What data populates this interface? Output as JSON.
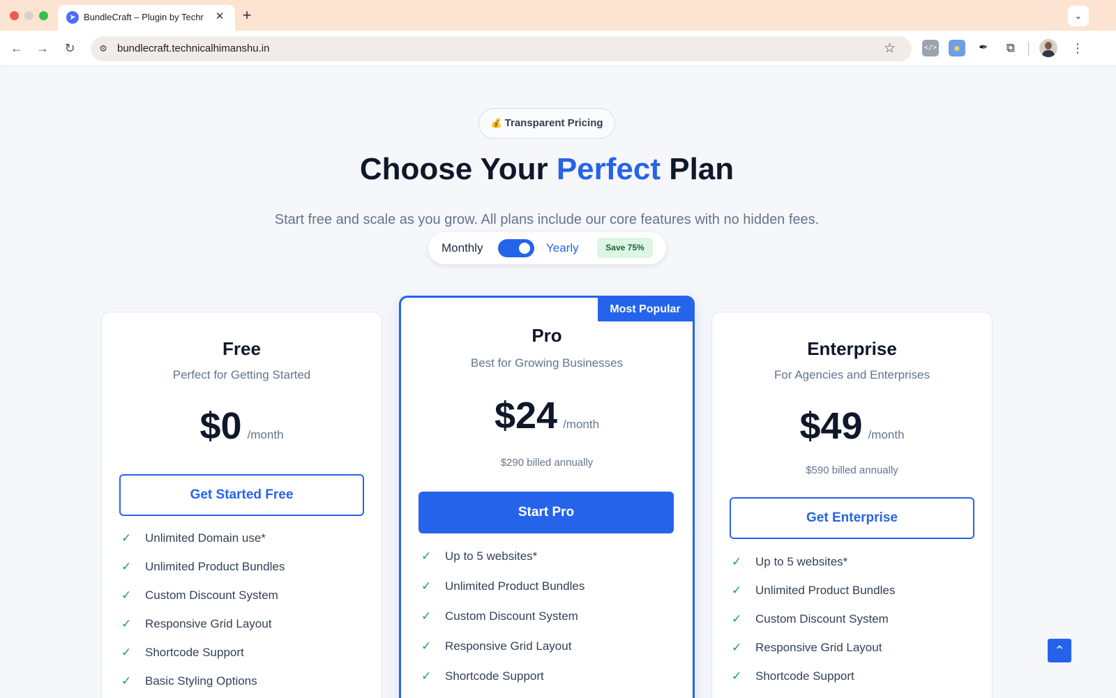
{
  "browser": {
    "tab_title": "BundleCraft – Plugin by Techr",
    "tab_favicon": "rocket-icon",
    "new_tab_symbol": "+",
    "close_symbol": "✕",
    "url": "bundlecraft.technicalhimanshu.in"
  },
  "hero": {
    "badge_emoji": "💰",
    "badge_text": "Transparent Pricing",
    "headline_before": "Choose Your ",
    "headline_accent": "Perfect",
    "headline_after": " Plan",
    "subtitle": "Start free and scale as you grow. All plans include our core features with no hidden fees."
  },
  "billing": {
    "monthly_label": "Monthly",
    "yearly_label": "Yearly",
    "save_label": "Save 75%",
    "yearly_selected": true
  },
  "plans": [
    {
      "name": "Free",
      "description": "Perfect for Getting Started",
      "price": "$0",
      "period": "/month",
      "billed": "",
      "cta": "Get Started Free",
      "features": [
        "Unlimited Domain use*",
        "Unlimited Product Bundles",
        "Custom Discount System",
        "Responsive Grid Layout",
        "Shortcode Support",
        "Basic Styling Options"
      ]
    },
    {
      "name": "Pro",
      "badge": "Most Popular",
      "description": "Best for Growing Businesses",
      "price": "$24",
      "period": "/month",
      "billed": "$290 billed annually",
      "cta": "Start Pro",
      "features": [
        "Up to 5 websites*",
        "Unlimited Product Bundles",
        "Custom Discount System",
        "Responsive Grid Layout",
        "Shortcode Support"
      ]
    },
    {
      "name": "Enterprise",
      "description": "For Agencies and Enterprises",
      "price": "$49",
      "period": "/month",
      "billed": "$590 billed annually",
      "cta": "Get Enterprise",
      "features": [
        "Up to 5 websites*",
        "Unlimited Product Bundles",
        "Custom Discount System",
        "Responsive Grid Layout",
        "Shortcode Support"
      ]
    }
  ],
  "colors": {
    "accent": "#2563eb",
    "check": "#16a34a",
    "save_bg": "#dcf5e4"
  },
  "icons": {
    "check": "✓",
    "scroll_top": "chevron-up-icon"
  }
}
